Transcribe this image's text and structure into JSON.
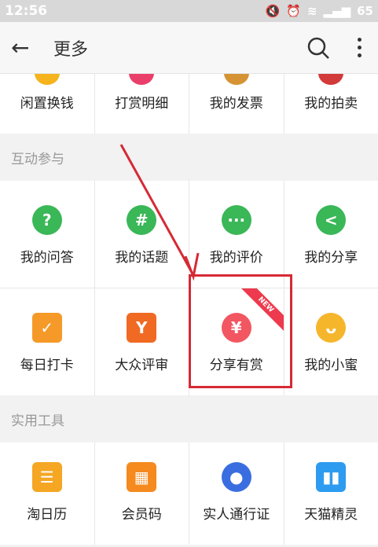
{
  "status": {
    "time": "12:56",
    "battery": "65"
  },
  "appbar": {
    "title": "更多"
  },
  "top_row": [
    {
      "label": "闲置换钱",
      "color": "#f5b31d"
    },
    {
      "label": "打赏明细",
      "color": "#ea3f6a"
    },
    {
      "label": "我的发票",
      "color": "#d59333"
    },
    {
      "label": "我的拍卖",
      "color": "#d33a3a"
    }
  ],
  "section_interact": {
    "title": "互动参与",
    "items": [
      {
        "label": "我的问答",
        "icon": "question-icon",
        "glyph": "?",
        "color": "#3ab757"
      },
      {
        "label": "我的话题",
        "icon": "hashtag-icon",
        "glyph": "#",
        "color": "#3ab757"
      },
      {
        "label": "我的评价",
        "icon": "comment-icon",
        "glyph": "···",
        "color": "#3ab757"
      },
      {
        "label": "我的分享",
        "icon": "share-icon",
        "glyph": "<",
        "color": "#3ab757"
      },
      {
        "label": "每日打卡",
        "icon": "calendar-check-icon",
        "glyph": "✓",
        "color": "#f59a28"
      },
      {
        "label": "大众评审",
        "icon": "review-icon",
        "glyph": "Y",
        "color": "#f06a23"
      },
      {
        "label": "分享有赏",
        "icon": "money-bag-icon",
        "glyph": "¥",
        "color": "#f25761",
        "badge": "NEW"
      },
      {
        "label": "我的小蜜",
        "icon": "assistant-icon",
        "glyph": "ᴗ",
        "color": "#f6b62c"
      }
    ]
  },
  "section_tools": {
    "title": "实用工具",
    "items": [
      {
        "label": "淘日历",
        "icon": "calendar-icon",
        "glyph": "☰",
        "color": "#f5a623"
      },
      {
        "label": "会员码",
        "icon": "qrcode-icon",
        "glyph": "▦",
        "color": "#f58a1f"
      },
      {
        "label": "实人通行证",
        "icon": "id-verify-icon",
        "glyph": "●",
        "color": "#3a6ee0"
      },
      {
        "label": "天猫精灵",
        "icon": "tmall-genie-icon",
        "glyph": "▮▮",
        "color": "#2d9cf0"
      }
    ]
  }
}
